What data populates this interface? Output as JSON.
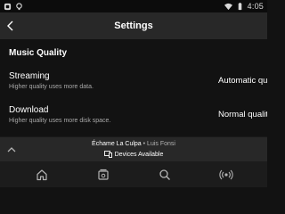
{
  "status_bar": {
    "time": "4:05",
    "left_icons": [
      "notification-icon",
      "lightbulb-icon"
    ],
    "right_icons": [
      "wifi-icon",
      "battery-icon"
    ]
  },
  "header": {
    "title": "Settings"
  },
  "music_quality": {
    "section_title": "Music Quality",
    "settings": [
      {
        "name": "Streaming",
        "description": "Higher quality uses more data.",
        "value": "Automatic quality"
      },
      {
        "name": "Download",
        "description": "Higher quality uses more disk space.",
        "value": "Normal quality"
      }
    ]
  },
  "now_playing": {
    "track": "Échame La Culpa",
    "separator": " • ",
    "artist": "Luis Fonsi",
    "devices_label": "Devices Available"
  },
  "bottom_nav": {
    "items": [
      "home-icon",
      "browse-icon",
      "search-icon",
      "radio-icon"
    ]
  },
  "colors": {
    "background": "#121212",
    "header": "#282828",
    "secondary_text": "#a8a8a8",
    "nav_background": "#1c1c1c"
  }
}
